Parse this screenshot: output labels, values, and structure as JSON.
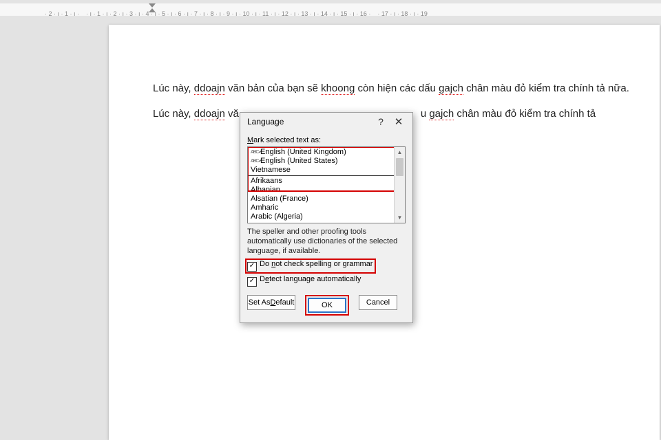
{
  "ruler_text": "  · 2 · ı · 1 · ı ·    · ı · 1 · ı · 2 · ı · 3 · ı · 4 · ı · 5 · ı · 6 · ı · 7 · ı · 8 · ı · 9 · ı · 10 · ı · 11 · ı · 12 · ı · 13 · ı · 14 · ı · 15 · ı · 16 ·    · 17 · ı · 18 · ı · 19",
  "doc": {
    "p1a": "Lúc này, ",
    "err1": "ddoajn",
    "p1b": " văn bản của bạn sẽ ",
    "err2": "khoong",
    "p1c": " còn hiện các dấu ",
    "err3": "gajch",
    "p1d": " chân màu đỏ kiểm tra chính tả nữa.",
    "p2a": "Lúc này, ",
    "err4": "ddoajn",
    "p2b": " vă",
    "p2c": "u ",
    "err5": "gajch",
    "p2d": " chân màu đỏ kiểm tra chính tả"
  },
  "dialog": {
    "title": "Language",
    "help": "?",
    "close": "✕",
    "mark_label_pre": "",
    "mark_label_u": "M",
    "mark_label_post": "ark selected text as:",
    "languages": [
      "English (United Kingdom)",
      "English (United States)",
      "Vietnamese",
      "Afrikaans",
      "Albanian",
      "Alsatian (France)",
      "Amharic",
      "Arabic (Algeria)"
    ],
    "info": "The speller and other proofing tools automatically use dictionaries of the selected language, if available.",
    "chk1_pre": "Do ",
    "chk1_u": "n",
    "chk1_post": "ot check spelling or grammar",
    "chk2_pre": "D",
    "chk2_u": "e",
    "chk2_post": "tect language automatically",
    "btn_default_pre": "Set As ",
    "btn_default_u": "D",
    "btn_default_post": "efault",
    "btn_ok": "OK",
    "btn_cancel": "Cancel"
  }
}
